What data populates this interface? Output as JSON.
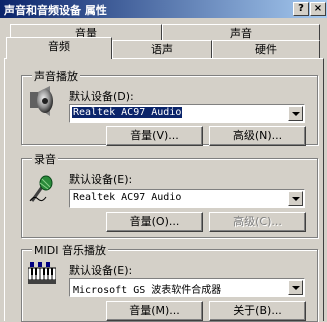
{
  "window": {
    "title": "声音和音频设备 属性",
    "help_glyph": "?",
    "close_glyph": "×"
  },
  "tabs": {
    "back_row": [
      "音量",
      "声音"
    ],
    "front_row": [
      "音频",
      "语声",
      "硬件"
    ],
    "active": "音频"
  },
  "sound_playback": {
    "title": "声音播放",
    "default_device_label": "默认设备(D):",
    "device_value": "Realtek AC97 Audio",
    "volume_button": "音量(V)...",
    "advanced_button": "高级(N)..."
  },
  "recording": {
    "title": "录音",
    "default_device_label": "默认设备(E):",
    "device_value": "Realtek AC97 Audio",
    "volume_button": "音量(O)...",
    "advanced_button": "高级(C)..."
  },
  "midi": {
    "title": "MIDI 音乐播放",
    "default_device_label": "默认设备(E):",
    "device_value": "Microsoft GS 波表软件合成器",
    "volume_button": "音量(M)...",
    "about_button": "关于(B)..."
  },
  "icons": [
    "speaker-icon",
    "microphone-icon",
    "midi-keyboard-icon",
    "mouse-cursor-icon"
  ]
}
